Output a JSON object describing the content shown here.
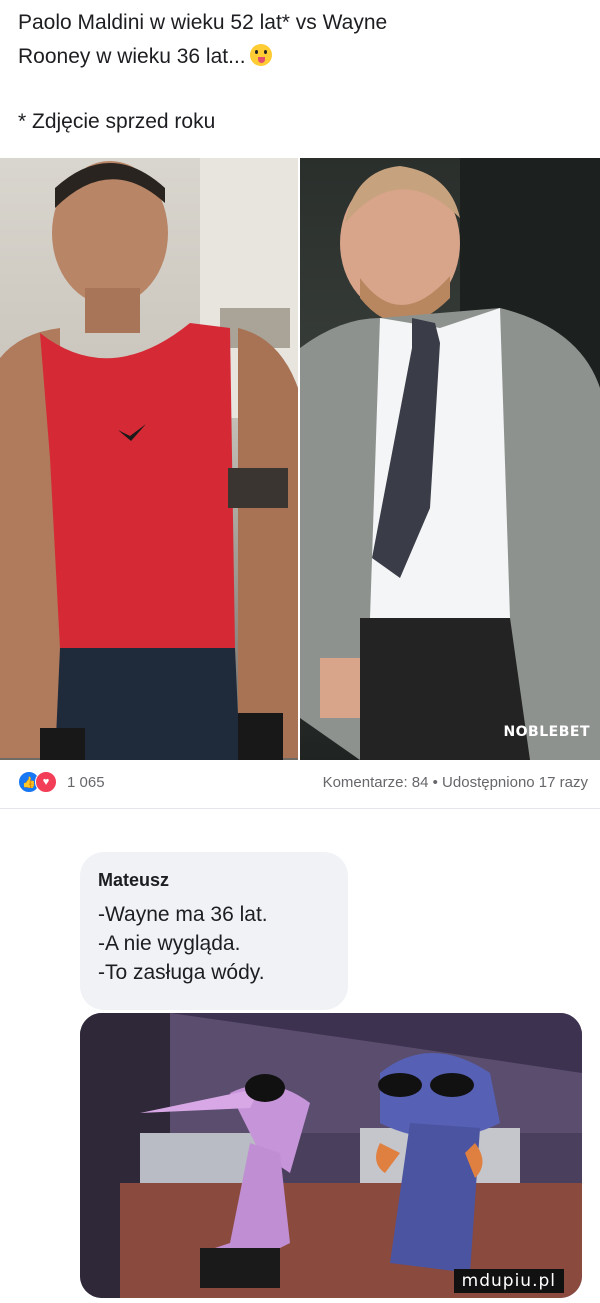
{
  "post": {
    "line1": "Paolo Maldini w wieku 52 lat* vs Wayne",
    "line2": "Rooney w wieku 36 lat...",
    "emoji": "tongue-out-emoji",
    "footnote": "* Zdjęcie sprzed roku"
  },
  "photos": {
    "watermark": "NOBLEBET"
  },
  "reactions": {
    "icons": [
      "like-icon",
      "love-icon"
    ],
    "count": "1 065",
    "stats": "Komentarze: 84 • Udostępniono 17 razy"
  },
  "comment": {
    "author": "Mateusz",
    "lines": [
      "-Wayne ma 36 lat.",
      "-A nie wygląda.",
      "-To zasługa wódy."
    ]
  },
  "site_tag": "mdupiu.pl",
  "colors": {
    "like": "#1877f2",
    "love": "#f33e58",
    "bubble": "#f0f2f5"
  }
}
